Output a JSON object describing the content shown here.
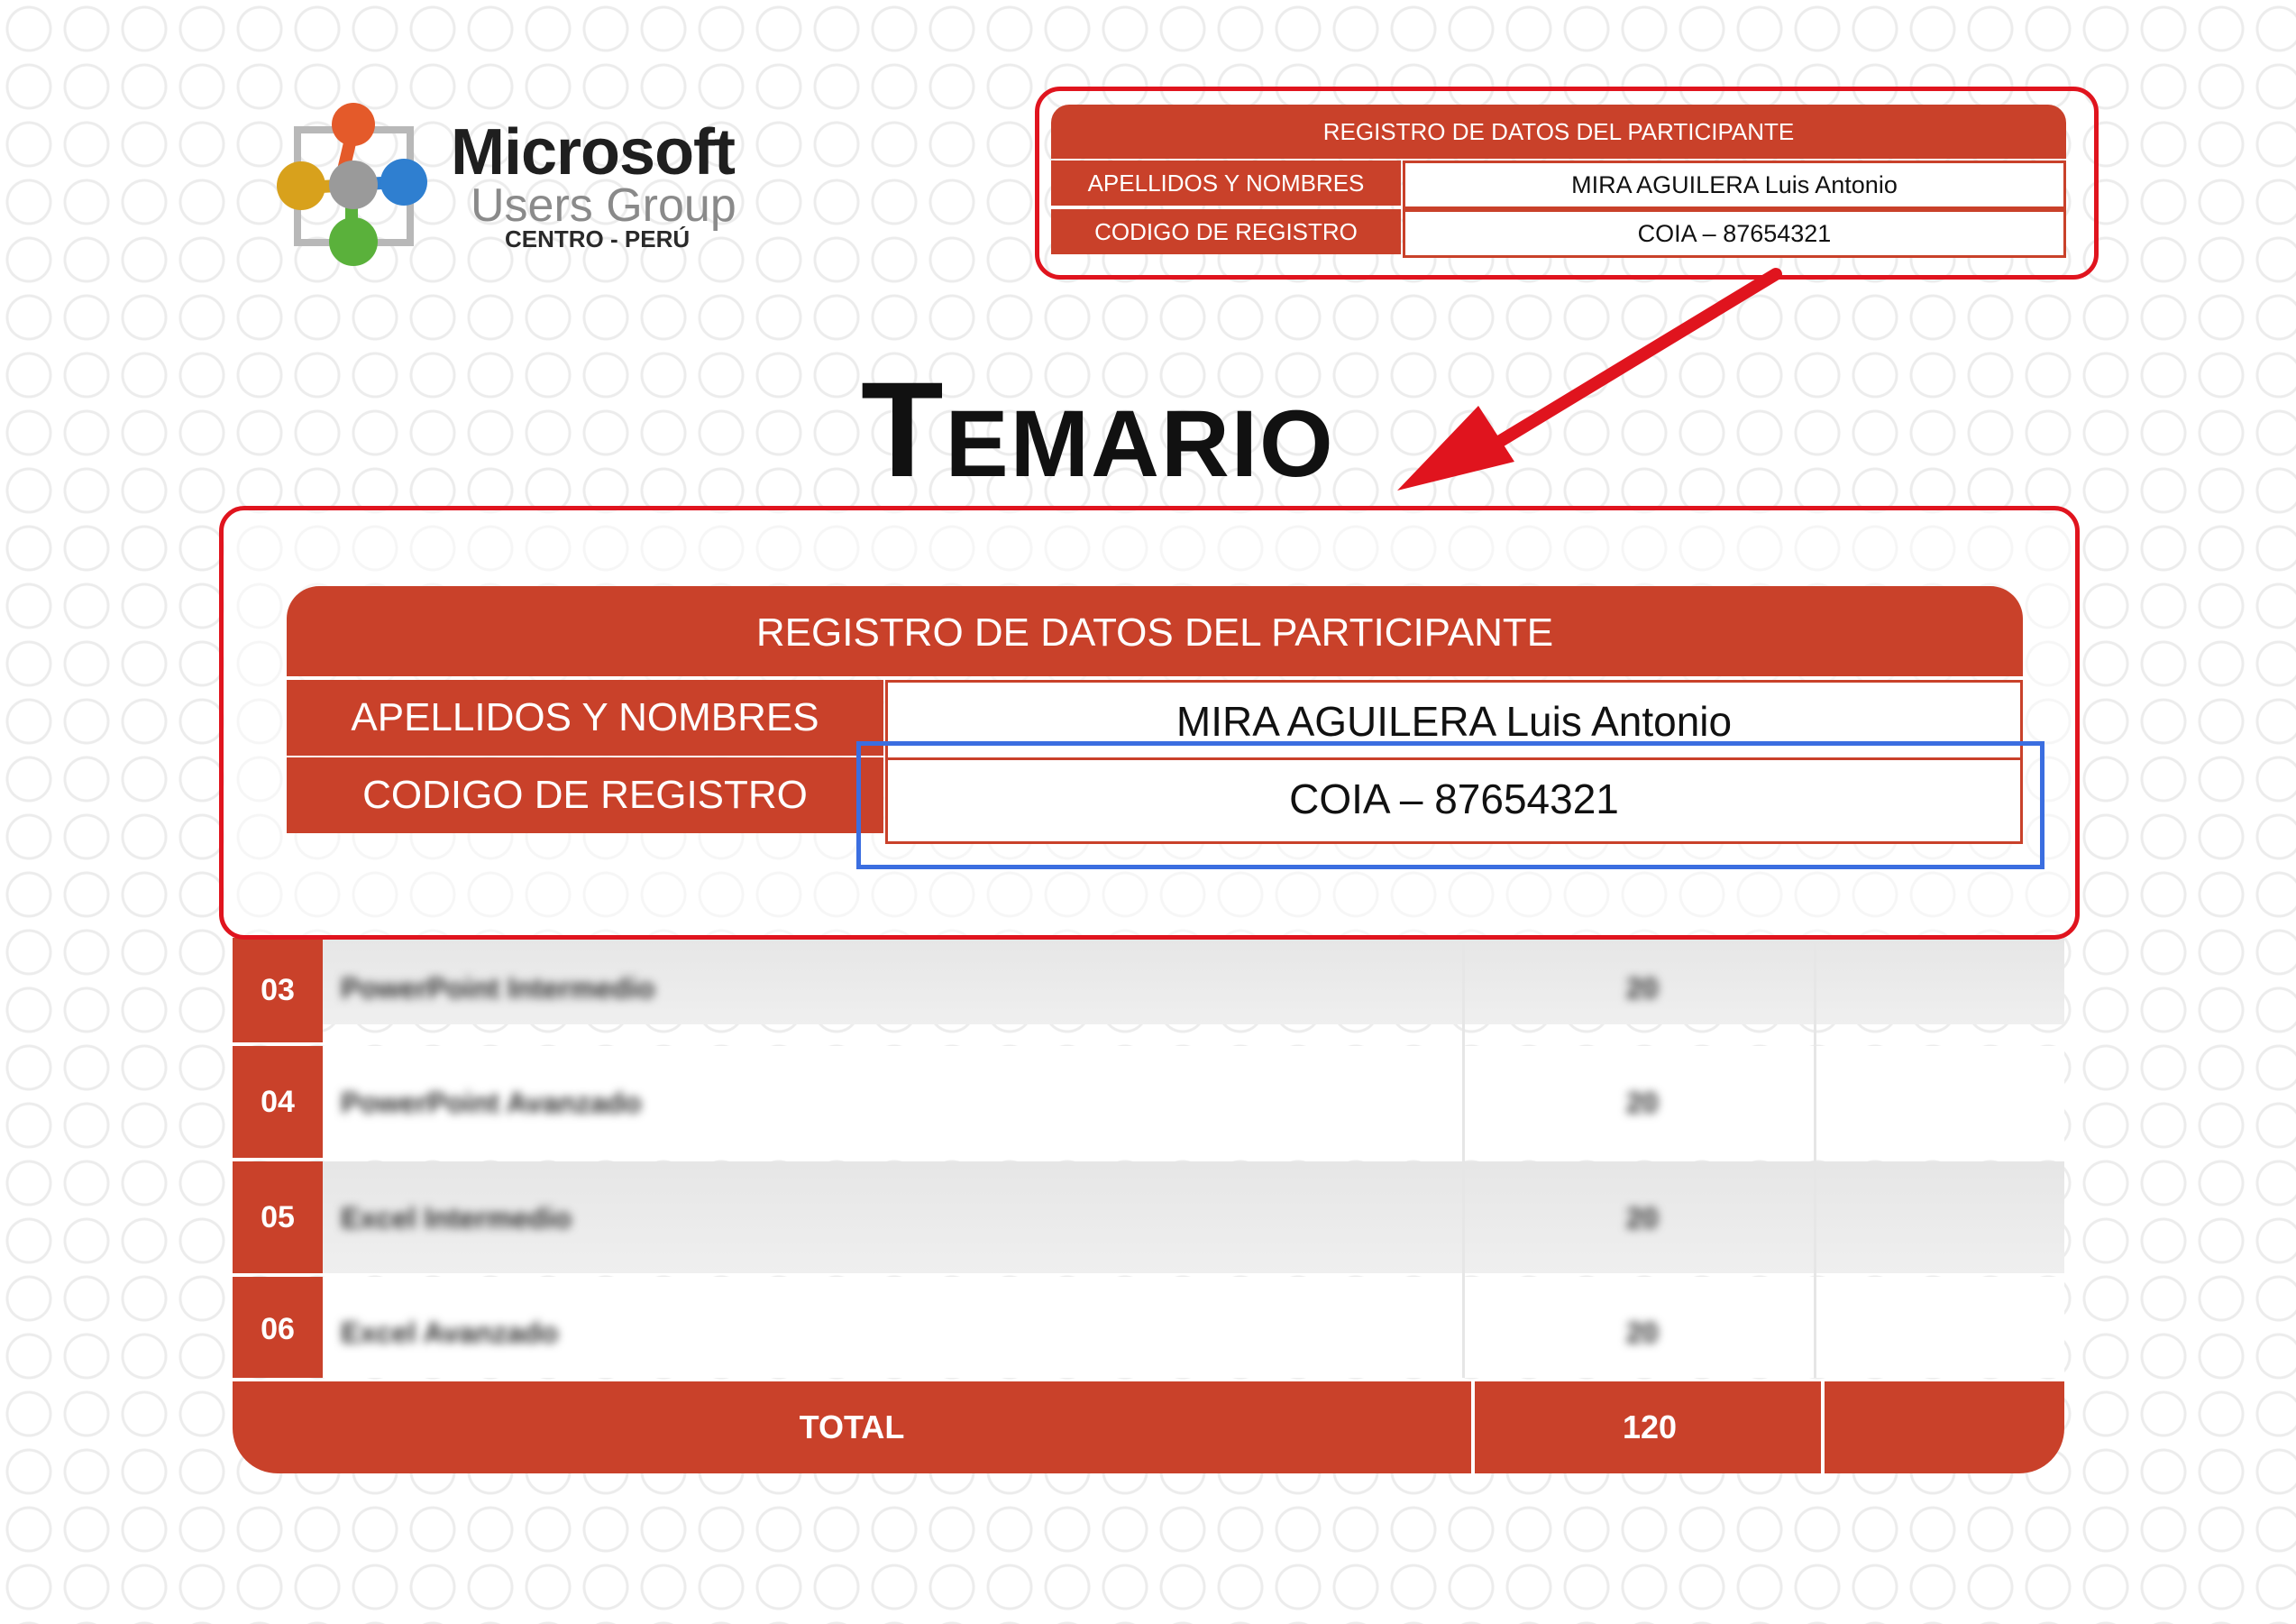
{
  "logo": {
    "brand": "Microsoft",
    "subtitle": "Users Group",
    "location": "CENTRO - PERÚ",
    "dot_colors": [
      "#e45a2a",
      "#d8a11c",
      "#9a9a9a",
      "#2f7fd0",
      "#5ab13b"
    ]
  },
  "registro": {
    "header": "REGISTRO DE DATOS DEL PARTICIPANTE",
    "rows": [
      {
        "label": "APELLIDOS Y NOMBRES",
        "value": "MIRA AGUILERA Luis Antonio"
      },
      {
        "label": "CODIGO DE REGISTRO",
        "value": "COIA – 87654321"
      }
    ]
  },
  "title": "Temario",
  "table": {
    "rows": [
      {
        "num": "03",
        "course": "PowerPoint Intermedio",
        "hours": "20"
      },
      {
        "num": "04",
        "course": "PowerPoint Avanzado",
        "hours": "20"
      },
      {
        "num": "05",
        "course": "Excel Intermedio",
        "hours": "20"
      },
      {
        "num": "06",
        "course": "Excel Avanzado",
        "hours": "20"
      }
    ],
    "total_label": "TOTAL",
    "total_value": "120"
  },
  "colors": {
    "accent": "#c9412a",
    "highlight_red": "#e0141e",
    "highlight_blue": "#3b6ee0"
  }
}
